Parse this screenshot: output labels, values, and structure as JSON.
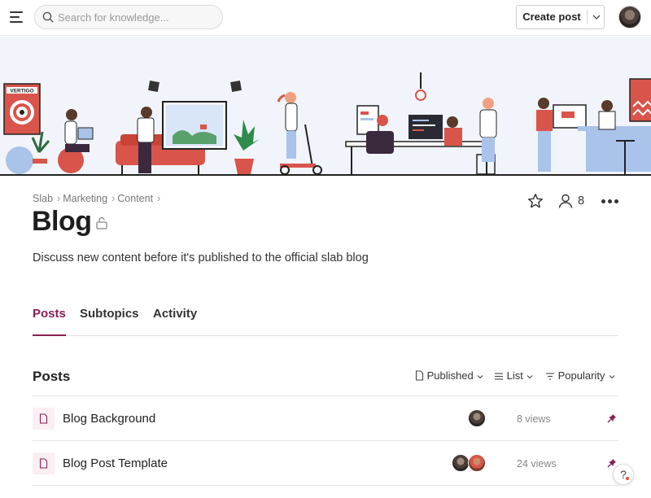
{
  "header": {
    "search_placeholder": "Search for knowledge...",
    "create_post_label": "Create post"
  },
  "breadcrumb": [
    "Slab",
    "Marketing",
    "Content"
  ],
  "topic": {
    "title": "Blog",
    "description": "Discuss new content before it's published to the official slab blog",
    "member_count": "8"
  },
  "tabs": [
    {
      "label": "Posts",
      "active": true
    },
    {
      "label": "Subtopics",
      "active": false
    },
    {
      "label": "Activity",
      "active": false
    }
  ],
  "posts_section": {
    "title": "Posts",
    "filters": {
      "status": "Published",
      "view": "List",
      "sort": "Popularity"
    }
  },
  "posts": [
    {
      "name": "Blog Background",
      "views": "8 views",
      "avatars": [
        "dark"
      ],
      "pinned": true
    },
    {
      "name": "Blog Post Template",
      "views": "24 views",
      "avatars": [
        "dark",
        "light"
      ],
      "pinned": true
    }
  ],
  "banner": {
    "poster_text": "VERTIGO"
  },
  "colors": {
    "accent": "#8a1f55",
    "banner_bg": "#f1f4fa",
    "illustration_red": "#d9544a",
    "illustration_blue": "#a9c3ea"
  },
  "icons": {
    "menu": "menu-icon",
    "search": "search-icon",
    "star": "star-icon",
    "members": "person-icon",
    "more": "more-dots-icon",
    "lock": "lock-icon",
    "document": "document-icon",
    "pin": "pin-icon",
    "help": "help-icon"
  }
}
